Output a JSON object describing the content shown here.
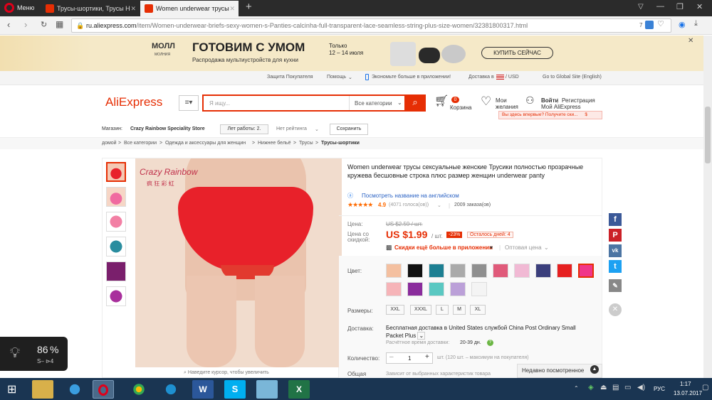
{
  "browser": {
    "menu_label": "Меню",
    "tabs": [
      {
        "label": "Трусы-шортики, Трусы H"
      },
      {
        "label": "Women underwear трусы"
      }
    ],
    "url_host": "ru.aliexpress.com",
    "url_path": "/item/Women-underwear-briefs-sexy-women-s-Panties-calcinha-full-transparent-lace-seamless-string-plus-size-women/32381800317.html",
    "badge_count": "7"
  },
  "banner": {
    "logo_line1": "МОЛЛ",
    "logo_line2": "МОЛНИЯ",
    "headline": "ГОТОВИМ С УМОМ",
    "subline": "Распродажа мультиустройств для кухни",
    "date_line1": "Только",
    "date_line2": "12 – 14 июля",
    "cta": "КУПИТЬ СЕЙЧАС"
  },
  "topnav": {
    "buyer_protection": "Защита Покупателя",
    "help": "Помощь",
    "app_save": "Экономьте больше в приложении!",
    "delivery": "Доставка в",
    "currency": "/ USD",
    "global_site": "Go to Global Site (English)"
  },
  "header": {
    "logo": "AliExpress",
    "search_placeholder": "Я ищу...",
    "category": "Все категории",
    "cart_count": "0",
    "cart_label": "Корзина",
    "wishlist_line1": "Мои",
    "wishlist_line2": "желания",
    "signin": "Войти",
    "register": "Регистрация",
    "my_account": "Мой AliExpress",
    "promo": "Вы здесь впервые? Получите ски...",
    "promo_amount": "$"
  },
  "store": {
    "label": "Магазин:",
    "name": "Crazy Rainbow Speciality Store",
    "years": "Лет работы: 2.",
    "rating": "Нет рейтинга",
    "save": "Сохранить"
  },
  "breadcrumb": {
    "items": [
      "домой",
      "Все категории",
      "Одежда и аксессуары для женщин",
      "Нижнее бельё",
      "Трусы",
      "Трусы-шортики"
    ]
  },
  "gallery": {
    "watermark_line1": "Crazy Rainbow",
    "watermark_line2": "疯 狂 彩 虹",
    "zoom_hint": "Наведите курсор, чтобы увеличить"
  },
  "product": {
    "title": "Women underwear трусы сексуальные женские Трусики полностью прозрачные кружева бесшовные строка плюс размер женщин underwear panty",
    "translate_link": "Посмотреть название на английском",
    "rating": "4.9",
    "votes": "(4071 голоса(ов))",
    "orders": "2009 заказа(ов)",
    "price_label": "Цена:",
    "old_price": "US $2.59 / шт.",
    "discount_label_line1": "Цена со",
    "discount_label_line2": "скидкой:",
    "price": "US $1.99",
    "price_unit": "/ шт.",
    "discount": "-23%",
    "days_left": "Осталось дней: 4",
    "app_discount": "Скидки ещё больше в приложении",
    "wholesale": "Оптовая цена",
    "color_label": "Цвет:",
    "sizes_label": "Размеры:",
    "sizes": [
      "XXL",
      "XXXL",
      "L",
      "M",
      "XL"
    ],
    "delivery_label": "Доставка:",
    "delivery_text": "Бесплатная доставка в United States службой China Post Ordinary Small Packet Plus",
    "delivery_time_label": "Расчётное время доставки:",
    "delivery_time": "20-39 дн.",
    "qty_label": "Количество:",
    "qty": "1",
    "qty_note": "шт. (120 шт. – максимум на покупателя)",
    "total_label": "Общая",
    "total_note": "Зависит от выбранных характеристик товара"
  },
  "recently_viewed": "Недавно посмотренное",
  "widget": {
    "percent": "86",
    "unit": "%",
    "speed": "S– ⊳4"
  },
  "taskbar": {
    "lang": "РУС",
    "time": "1:17",
    "date": "13.07.2017"
  },
  "colors": {
    "accent": "#e62e04",
    "orange": "#ff6a00",
    "facebook": "#3b5998",
    "pinterest": "#cb2027",
    "vk": "#4c75a3",
    "twitter": "#1da1f2"
  }
}
